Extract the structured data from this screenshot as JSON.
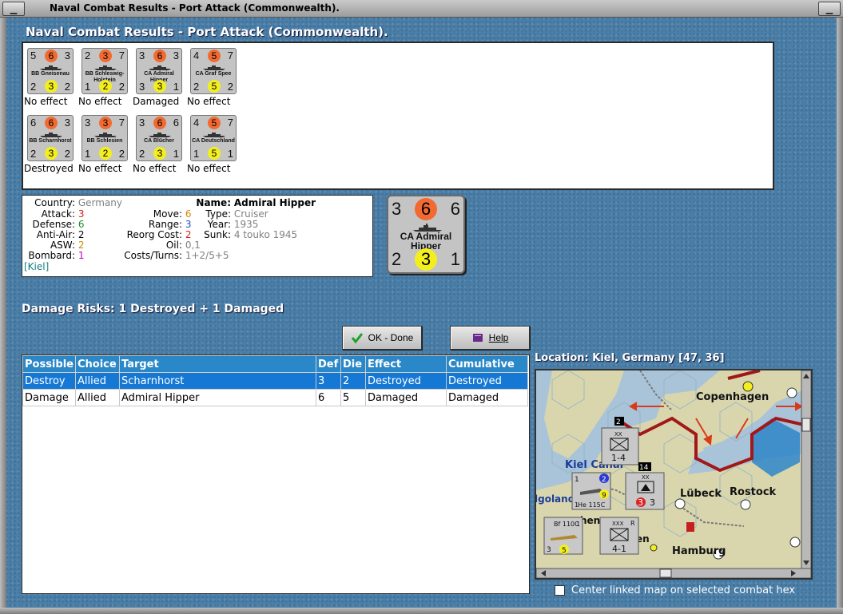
{
  "window": {
    "title": "Naval Combat Results - Port Attack (Commonwealth).",
    "heading": "Naval Combat Results - Port Attack (Commonwealth)."
  },
  "units": [
    {
      "name": "BB Gneisenau",
      "tl": "5",
      "top": "6",
      "tr": "3",
      "bl": "2",
      "bot": "3",
      "br": "2",
      "effect": "No effect"
    },
    {
      "name": "BB Schleswig-Holstein",
      "tl": "2",
      "top": "3",
      "tr": "7",
      "bl": "1",
      "bot": "2",
      "br": "2",
      "effect": "No effect"
    },
    {
      "name": "CA Admiral Hipper",
      "tl": "3",
      "top": "6",
      "tr": "3",
      "bl": "3",
      "bot": "3",
      "br": "1",
      "effect": "Damaged"
    },
    {
      "name": "CA Graf Spee",
      "tl": "4",
      "top": "5",
      "tr": "7",
      "bl": "2",
      "bot": "5",
      "br": "2",
      "effect": "No effect"
    },
    {
      "name": "BB Scharnhorst",
      "tl": "6",
      "top": "6",
      "tr": "3",
      "bl": "2",
      "bot": "3",
      "br": "2",
      "effect": "Destroyed"
    },
    {
      "name": "BB Schlesien",
      "tl": "3",
      "top": "3",
      "tr": "7",
      "bl": "1",
      "bot": "2",
      "br": "2",
      "effect": "No effect"
    },
    {
      "name": "CA Blücher",
      "tl": "3",
      "top": "6",
      "tr": "6",
      "bl": "2",
      "bot": "3",
      "br": "1",
      "effect": "No effect"
    },
    {
      "name": "CA Deutschland",
      "tl": "4",
      "top": "5",
      "tr": "7",
      "bl": "1",
      "bot": "5",
      "br": "1",
      "effect": "No effect"
    }
  ],
  "info": {
    "country_label": "Country:",
    "country": "Germany",
    "attack_label": "Attack:",
    "attack": "3",
    "defense_label": "Defense:",
    "defense": "6",
    "antiair_label": "Anti-Air:",
    "antiair": "2",
    "asw_label": "ASW:",
    "asw": "2",
    "bombard_label": "Bombard:",
    "bombard": "1",
    "location": "[Kiel]",
    "move_label": "Move:",
    "move": "6",
    "range_label": "Range:",
    "range": "3",
    "reorg_label": "Reorg Cost:",
    "reorg": "2",
    "oil_label": "Oil:",
    "oil": "0,1",
    "costs_label": "Costs/Turns:",
    "costs": "1+2/5+5",
    "name_label": "Name:",
    "name": "Admiral Hipper",
    "type_label": "Type:",
    "type": "Cruiser",
    "year_label": "Year:",
    "year": "1935",
    "sunk_label": "Sunk:",
    "sunk": "4 touko 1945"
  },
  "big_counter": {
    "tl": "3",
    "top": "6",
    "tr": "6",
    "bl": "2",
    "bot": "3",
    "br": "1",
    "name": "CA Admiral Hipper"
  },
  "damage_risks": "Damage Risks:  1 Destroyed + 1 Damaged",
  "buttons": {
    "ok": "OK - Done",
    "help": "Help"
  },
  "location_label": "Location:  Kiel, Germany [47, 36]",
  "table": {
    "headers": [
      "Possible",
      "Choice",
      "Target",
      "Def",
      "Die",
      "Effect",
      "Cumulative"
    ],
    "rows": [
      [
        "Destroy",
        "Allied",
        "Scharnhorst",
        "3",
        "2",
        "Destroyed",
        "Destroyed"
      ],
      [
        "Damage",
        "Allied",
        "Admiral Hipper",
        "6",
        "5",
        "Damaged",
        "Damaged"
      ]
    ]
  },
  "map": {
    "labels": {
      "copenhagen": "Copenhagen",
      "kiel": "Kiel Canal",
      "lubeck": "Lübeck",
      "rostock": "Rostock",
      "hamburg": "Hamburg",
      "helgoland": "lgoland",
      "bremen_frag": "hen",
      "en_frag": "en"
    },
    "counters": {
      "c1_top": "2",
      "c1_bottom": "1-4",
      "c1_size": "XX",
      "c2_top": "14",
      "c2_size": "XX",
      "c2_left": "3",
      "c2_right": "3",
      "c3_tl": "1",
      "c3_tr": "2",
      "c3_name": "He 115C",
      "c3_bl": "1",
      "c3_br": "9",
      "c4_name": "Bf 110C",
      "c4_tr": "1",
      "c4_bl": "3",
      "c4_br": "5",
      "c5_size": "XXX",
      "c5_r": "R",
      "c5_bottom": "4-1"
    }
  },
  "checkbox_label": "Center linked map on selected combat hex",
  "colors": {
    "accent_blue": "#2a87c8",
    "selected_row": "#1478d4",
    "attack_dot": "#f26a32",
    "defense_dot": "#f3ef1e"
  }
}
